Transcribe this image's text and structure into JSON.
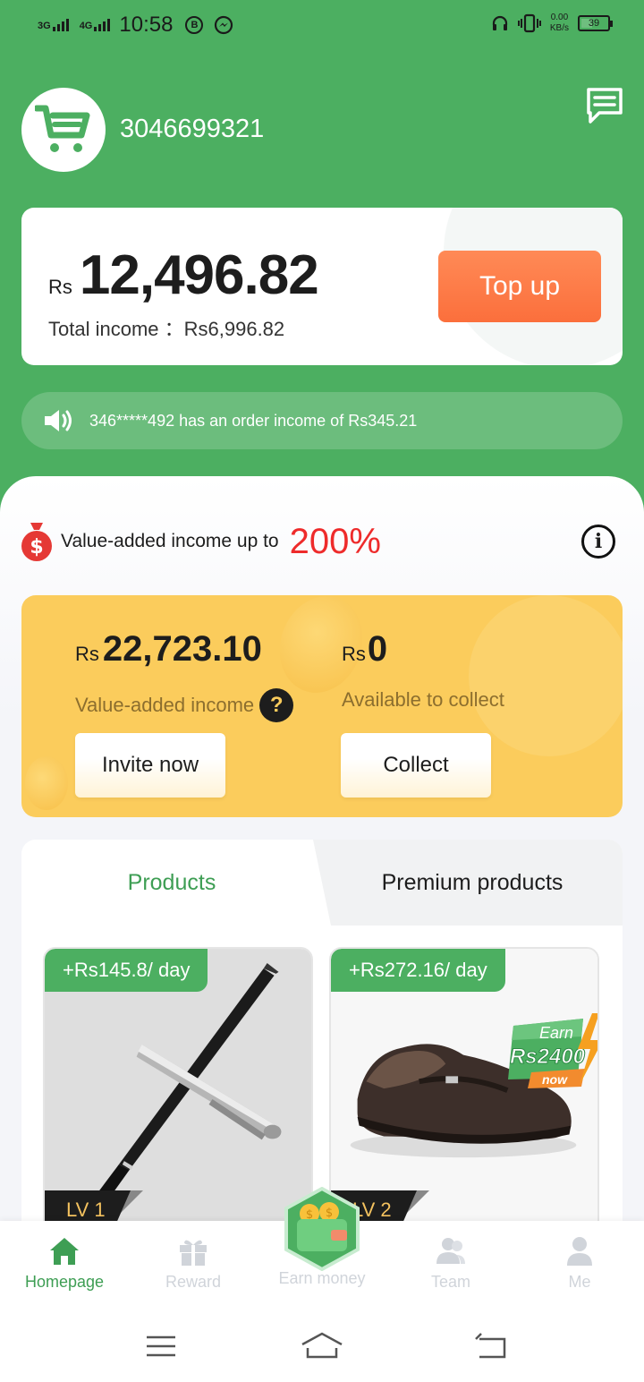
{
  "status_bar": {
    "sig1": "3G",
    "sig2": "4G",
    "time": "10:58",
    "b_icon": "B",
    "net_speed_top": "0.00",
    "net_speed_unit": "KB/s",
    "battery": "39"
  },
  "header": {
    "username": "3046699321",
    "avatar_icon": "shopping-cart-icon",
    "chat_icon": "message-icon"
  },
  "balance": {
    "currency": "Rs",
    "amount": "12,496.82",
    "total_income_label": "Total income ：",
    "total_income_value": "Rs6,996.82",
    "topup_label": "Top up"
  },
  "notice": {
    "text": "346*****492 has an order income of Rs345.21"
  },
  "promo": {
    "text": "Value-added income up to",
    "percent": "200%"
  },
  "value_card": {
    "currency": "Rs",
    "va_amount": "22,723.10",
    "va_label": "Value-added income",
    "ac_amount": "0",
    "ac_label": "Available to collect",
    "invite_label": "Invite now",
    "collect_label": "Collect"
  },
  "products": {
    "tabs": [
      {
        "label": "Products",
        "active": true
      },
      {
        "label": "Premium products",
        "active": false
      }
    ],
    "items": [
      {
        "price": "+Rs145.8/ day",
        "level": "LV 1",
        "image": "pen"
      },
      {
        "price": "+Rs272.16/ day",
        "level": "LV 2",
        "image": "shoe"
      }
    ],
    "earn_badge": {
      "top": "Earn",
      "amount": "Rs2400",
      "bottom": "now"
    }
  },
  "bottom_nav": [
    {
      "label": "Homepage",
      "icon": "home-icon",
      "active": true
    },
    {
      "label": "Reward",
      "icon": "gift-icon",
      "active": false
    },
    {
      "label": "Earn money",
      "icon": "wallet-icon",
      "active": false
    },
    {
      "label": "Team",
      "icon": "team-icon",
      "active": false
    },
    {
      "label": "Me",
      "icon": "person-icon",
      "active": false
    }
  ],
  "colors": {
    "primary_green": "#4caf61",
    "accent_orange": "#fb6f3c",
    "accent_red": "#ee2b2b",
    "card_yellow": "#fbcc5c"
  }
}
